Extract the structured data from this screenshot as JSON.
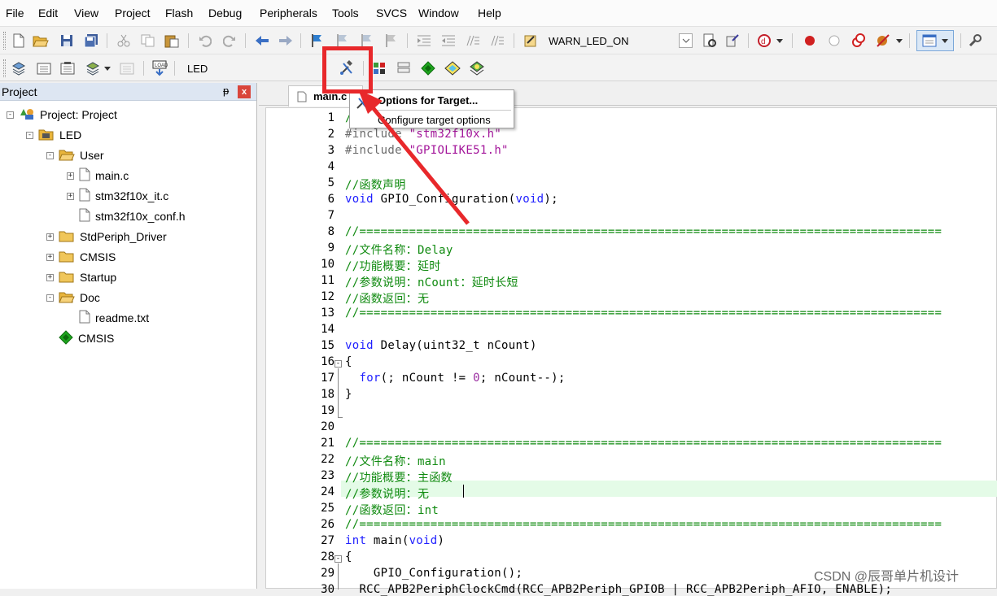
{
  "menu": [
    "File",
    "Edit",
    "View",
    "Project",
    "Flash",
    "Debug",
    "Peripherals",
    "Tools",
    "SVCS",
    "Window",
    "Help"
  ],
  "toolbar": {
    "find_value": "WARN_LED_ON",
    "target_value": "LED",
    "icons": [
      "new-file-icon",
      "open-folder-icon",
      "save-icon",
      "save-all-icon",
      "cut-icon",
      "copy-icon",
      "paste-icon",
      "undo-icon",
      "redo-icon",
      "navigate-back-icon",
      "navigate-forward-icon",
      "bookmark-icon",
      "prev-bookmark-icon",
      "next-bookmark-icon",
      "clear-bookmarks-icon",
      "indent-icon",
      "unindent-icon",
      "comment-icon",
      "uncomment-icon",
      "find-in-files-icon",
      "debug-icon",
      "breakpoint-icon",
      "options-for-target-icon",
      "manage-components-icon"
    ]
  },
  "project_panel": {
    "title": "Project",
    "pin": "ᵽ",
    "close": "x",
    "tree": [
      {
        "label": "Project: Project",
        "icon": "project-icon",
        "level": 0,
        "expander": "-"
      },
      {
        "label": "LED",
        "icon": "target-icon",
        "level": 1,
        "expander": "-"
      },
      {
        "label": "User",
        "icon": "folder-open-icon",
        "level": 2,
        "expander": "-"
      },
      {
        "label": "main.c",
        "icon": "file-icon",
        "level": 3,
        "expander": "+"
      },
      {
        "label": "stm32f10x_it.c",
        "icon": "file-icon",
        "level": 3,
        "expander": "+"
      },
      {
        "label": "stm32f10x_conf.h",
        "icon": "file-icon",
        "level": 3,
        "expander": ""
      },
      {
        "label": "StdPeriph_Driver",
        "icon": "folder-icon",
        "level": 2,
        "expander": "+"
      },
      {
        "label": "CMSIS",
        "icon": "folder-icon",
        "level": 2,
        "expander": "+"
      },
      {
        "label": "Startup",
        "icon": "folder-icon",
        "level": 2,
        "expander": "+"
      },
      {
        "label": "Doc",
        "icon": "folder-open-icon",
        "level": 2,
        "expander": "-"
      },
      {
        "label": "readme.txt",
        "icon": "file-icon",
        "level": 3,
        "expander": ""
      },
      {
        "label": "CMSIS",
        "icon": "cmsis-component-icon",
        "level": 2,
        "expander": ""
      }
    ]
  },
  "editor": {
    "tab_label": "main.c",
    "lines": [
      {
        "n": "1",
        "text": "/"
      },
      {
        "n": "2",
        "text": "#include \"stm32f10x.h\""
      },
      {
        "n": "3",
        "text": "#include \"GPIOLIKE51.h\""
      },
      {
        "n": "4",
        "text": ""
      },
      {
        "n": "5",
        "text": "//函数声明"
      },
      {
        "n": "6",
        "text": "void GPIO_Configuration(void);"
      },
      {
        "n": "7",
        "text": ""
      },
      {
        "n": "8",
        "text": "//=================================================================================="
      },
      {
        "n": "9",
        "text": "//文件名称：Delay"
      },
      {
        "n": "10",
        "text": "//功能概要：延时"
      },
      {
        "n": "11",
        "text": "//参数说明：nCount：延时长短"
      },
      {
        "n": "12",
        "text": "//函数返回：无"
      },
      {
        "n": "13",
        "text": "//=================================================================================="
      },
      {
        "n": "14",
        "text": ""
      },
      {
        "n": "15",
        "text": "void Delay(uint32_t nCount)"
      },
      {
        "n": "16",
        "text": "{"
      },
      {
        "n": "17",
        "text": "  for(; nCount != 0; nCount--);"
      },
      {
        "n": "18",
        "text": "}"
      },
      {
        "n": "19",
        "text": ""
      },
      {
        "n": "20",
        "text": ""
      },
      {
        "n": "21",
        "text": "//=================================================================================="
      },
      {
        "n": "22",
        "text": "//文件名称：main"
      },
      {
        "n": "23",
        "text": "//功能概要：主函数"
      },
      {
        "n": "24",
        "text": "//参数说明：无"
      },
      {
        "n": "25",
        "text": "//函数返回：int"
      },
      {
        "n": "26",
        "text": "//=================================================================================="
      },
      {
        "n": "27",
        "text": "int main(void)"
      },
      {
        "n": "28",
        "text": "{"
      },
      {
        "n": "29",
        "text": "    GPIO_Configuration();"
      },
      {
        "n": "30",
        "text": "  RCC_APB2PeriphClockCmd(RCC_APB2Periph_GPIOB | RCC_APB2Periph_AFIO, ENABLE);"
      }
    ]
  },
  "tooltip": {
    "title": "Options for Target...",
    "subtitle": "Configure target options"
  },
  "watermark": "CSDN @辰哥单片机设计",
  "colors": {
    "highlight": "#e8282b",
    "comment": "#0f8a0f",
    "keyword": "#2020ff",
    "string": "#a3159a"
  }
}
